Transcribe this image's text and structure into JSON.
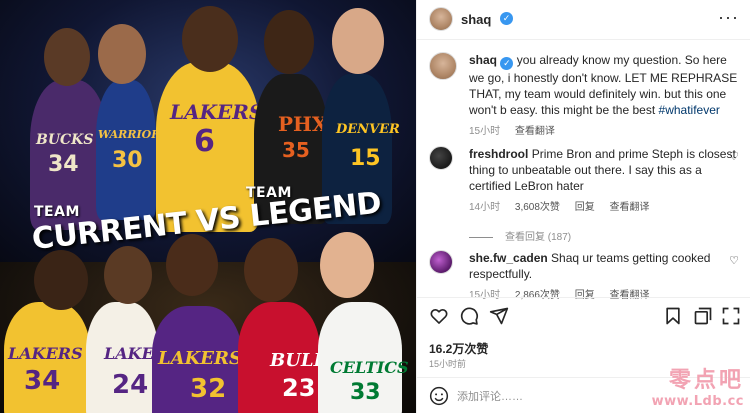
{
  "post": {
    "image_top_label_left": "TEAM",
    "image_top_label_right": "TEAM",
    "image_headline": "CURRENT VS LEGEND",
    "jerseys": {
      "bucks_name": "BUCKS",
      "bucks_num": "34",
      "warriors_name": "WARRIORS",
      "warriors_num": "30",
      "lakers_name": "LAKERS",
      "lakers_num": "6",
      "suns_name": "PHX",
      "suns_num": "35",
      "nuggets_name": "DENVER",
      "nuggets_num": "15",
      "legend_lakers1": "LAKERS",
      "legend_lakers1_num": "34",
      "legend_lakers2": "LAKERS",
      "legend_lakers2_num": "24",
      "legend_lakers3": "LAKERS",
      "legend_lakers3_num": "32",
      "bulls_name": "BULLS",
      "bulls_num": "23",
      "celtics_name": "CELTICS",
      "celtics_num": "33"
    }
  },
  "header": {
    "username": "shaq",
    "more": "···"
  },
  "caption": {
    "username": "shaq",
    "text": "you already know my question. So here we go, i honestly don't know. LET ME REPHRASE THAT, my team would definitely win. but this one won't b easy. this might be the best ",
    "hashtag": "#whatifever",
    "time": "15小时",
    "translate": "查看翻译"
  },
  "comments": [
    {
      "username": "freshdrool",
      "text": "Prime Bron and prime Steph is closest thing to unbeatable out there. I say this as a certified LeBron hater",
      "time": "14小时",
      "likes": "3,608次赞",
      "reply": "回复",
      "translate": "查看翻译",
      "view_replies": "查看回复 (187)"
    },
    {
      "username": "she.fw_caden",
      "text": "Shaq ur teams getting cooked respectfully.",
      "time": "15小时",
      "likes": "2,866次赞",
      "reply": "回复",
      "translate": "查看翻译"
    }
  ],
  "likes_count": "16.2万次赞",
  "post_time": "15小时前",
  "add_comment_placeholder": "添加评论……",
  "watermark": {
    "cn": "零点吧",
    "url": "www.Ldb.cc"
  }
}
